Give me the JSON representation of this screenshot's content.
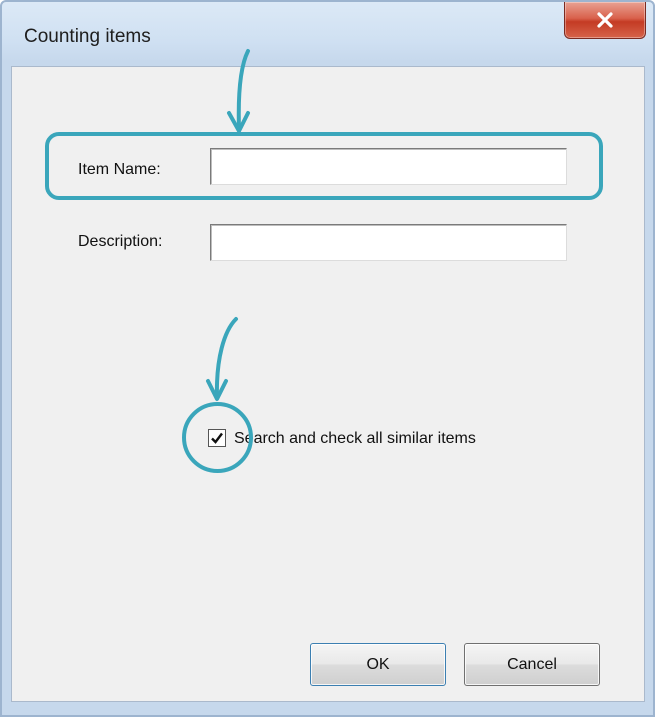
{
  "window": {
    "title": "Counting items",
    "close_icon": "close-icon"
  },
  "form": {
    "item_name": {
      "label": "Item Name:",
      "value": "",
      "placeholder": ""
    },
    "description": {
      "label": "Description:",
      "value": "",
      "placeholder": ""
    },
    "similar_checkbox": {
      "label": "Search and check all similar items",
      "checked": true
    }
  },
  "buttons": {
    "ok_label": "OK",
    "cancel_label": "Cancel"
  },
  "annotations": {
    "color": "#3aa6bb",
    "arrow_icon": "arrow-down-icon"
  }
}
